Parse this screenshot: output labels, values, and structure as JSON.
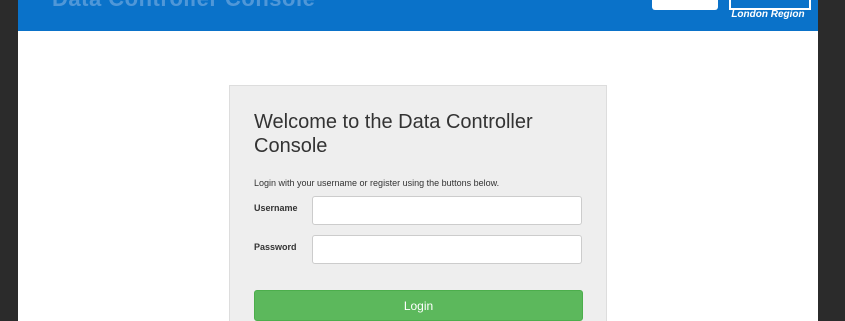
{
  "banner": {
    "title": "Data Controller Console",
    "region": "London Region"
  },
  "login": {
    "heading": "Welcome to the Data Controller Console",
    "instructions": "Login with your username or register using the buttons below.",
    "username_label": "Username",
    "password_label": "Password",
    "username_value": "",
    "password_value": "",
    "button_label": "Login"
  },
  "colors": {
    "banner": "#0a72c9",
    "panel": "#eeeeee",
    "login_button": "#5cb85c"
  }
}
